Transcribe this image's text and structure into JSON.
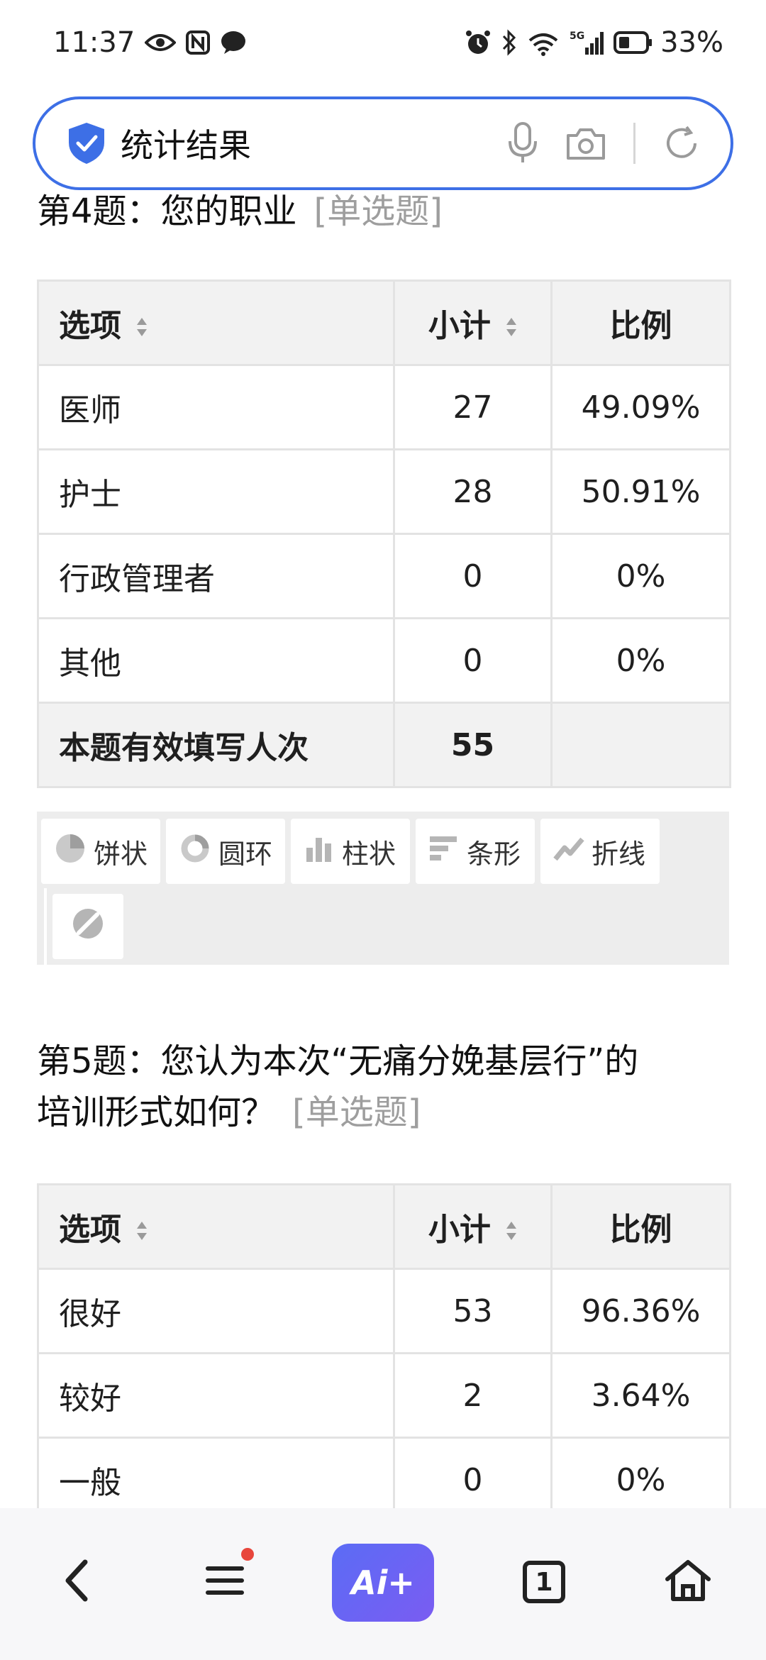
{
  "status_bar": {
    "time": "11:37",
    "battery": "33%",
    "network": "5G",
    "wifi_level": "6"
  },
  "search": {
    "title": "统计结果"
  },
  "questions": [
    {
      "title": "第4题：您的职业",
      "type_tag": "[单选题]",
      "headers": {
        "option": "选项",
        "count": "小计",
        "ratio": "比例"
      },
      "rows": [
        {
          "option": "医师",
          "count": "27",
          "ratio": "49.09%"
        },
        {
          "option": "护士",
          "count": "28",
          "ratio": "50.91%"
        },
        {
          "option": "行政管理者",
          "count": "0",
          "ratio": "0%"
        },
        {
          "option": "其他",
          "count": "0",
          "ratio": "0%"
        }
      ],
      "total": {
        "label": "本题有效填写人次",
        "count": "55"
      }
    },
    {
      "title_line1": "第5题：您认为本次“无痛分娩基层行”的",
      "title_line2": "培训形式如何？",
      "type_tag": "[单选题]",
      "headers": {
        "option": "选项",
        "count": "小计",
        "ratio": "比例"
      },
      "rows": [
        {
          "option": "很好",
          "count": "53",
          "ratio": "96.36%"
        },
        {
          "option": "较好",
          "count": "2",
          "ratio": "3.64%"
        },
        {
          "option": "一般",
          "count": "0",
          "ratio": "0%"
        }
      ]
    }
  ],
  "chart_types": [
    {
      "label": "饼状",
      "icon": "pie-chart-icon"
    },
    {
      "label": "圆环",
      "icon": "donut-chart-icon"
    },
    {
      "label": "柱状",
      "icon": "column-chart-icon"
    },
    {
      "label": "条形",
      "icon": "bar-chart-icon"
    },
    {
      "label": "折线",
      "icon": "line-chart-icon"
    },
    {
      "label": "",
      "icon": "hide-chart-icon"
    }
  ],
  "bottom_nav": {
    "ai_label": "Ai+",
    "tab_count": "1"
  },
  "colors": {
    "accent": "#3d6fe6",
    "ai_gradient_start": "#5b6cf5",
    "ai_gradient_end": "#7a5cf2",
    "tag_gray": "#9e9e9e"
  }
}
